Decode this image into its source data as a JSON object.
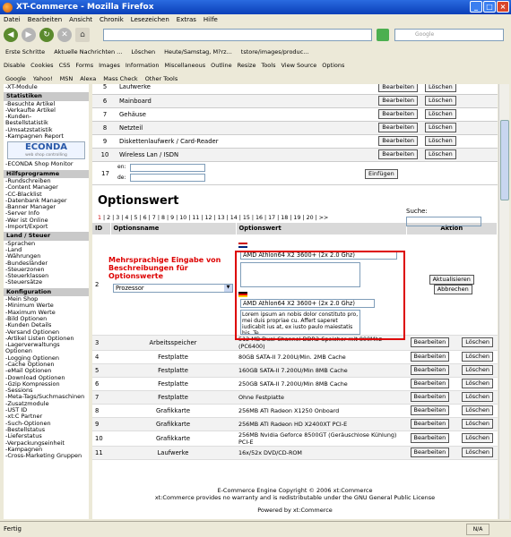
{
  "window": {
    "title": "XT-Commerce - Mozilla Firefox"
  },
  "menu": [
    "Datei",
    "Bearbeiten",
    "Ansicht",
    "Chronik",
    "Lesezeichen",
    "Extras",
    "Hilfe"
  ],
  "search": {
    "placeholder": "Google"
  },
  "bookmarks": [
    "Erste Schritte",
    "Aktuelle Nachrichten ...",
    "Löschen",
    "Heute/Samstag, M?rz...",
    "tstore/images/produc..."
  ],
  "devbar": [
    "Disable",
    "Cookies",
    "CSS",
    "Forms",
    "Images",
    "Information",
    "Miscellaneous",
    "Outline",
    "Resize",
    "Tools",
    "View Source",
    "Options"
  ],
  "googlebar": [
    "Google",
    "Yahoo!",
    "MSN",
    "Alexa",
    "Mass Check",
    "Other Tools"
  ],
  "sidebar": {
    "top_items": [
      "-XT-Module"
    ],
    "stats_title": "Statistiken",
    "stats_items": [
      "-Besuchte Artikel",
      "-Verkaufte Artikel",
      "-Kunden-",
      "Bestellstatistik",
      "-Umsatzstatistik",
      "-Kampagnen Report"
    ],
    "econda_logo": "ECONDA",
    "econda_sub": "web shop controlling",
    "econda_monitor": "-ECONDA Shop Monitor",
    "tools_title": "Hilfsprogramme",
    "tools_items": [
      "-Rundschreiben",
      "-Content Manager",
      "-CC-Blacklist",
      "-Datenbank Manager",
      "-Banner Manager",
      "-Server Info",
      "-Wer ist Online",
      "-Import/Export"
    ],
    "land_title": "Land / Steuer",
    "land_items": [
      "-Sprachen",
      "-Land",
      "-Währungen",
      "-Bundesländer",
      "-Steuerzonen",
      "-Steuerklassen",
      "-Steuersätze"
    ],
    "config_title": "Konfiguration",
    "config_items": [
      "-Mein Shop",
      "-Minimum Werte",
      "-Maximum Werte",
      "-Bild Optionen",
      "-Kunden Details",
      "-Versand Optionen",
      "-Artikel Listen Optionen",
      "-Lagerverwaltungs",
      "Optionen",
      "-Logging Optionen",
      "-Cache Optionen",
      "-eMail Optionen",
      "-Download Optionen",
      "-Gzip Kompression",
      "-Sessions",
      "-Meta-Tags/Suchmaschinen",
      "-Zusatzmodule",
      "-UST ID",
      "-xt:C Partner",
      "-Such-Optionen",
      "-Bestellstatus",
      "-Lieferstatus",
      "-Verpackungseinheit",
      "-Kampagnen",
      "-Cross-Marketing Gruppen"
    ]
  },
  "buttons": {
    "edit": "Bearbeiten",
    "delete": "Löschen",
    "add": "Einfügen",
    "update": "Aktualisieren",
    "cancel": "Abbrechen"
  },
  "top_rows": [
    {
      "id": "5",
      "name": "Laufwerke"
    },
    {
      "id": "6",
      "name": "Mainboard"
    },
    {
      "id": "7",
      "name": "Gehäuse"
    },
    {
      "id": "8",
      "name": "Netzteil"
    },
    {
      "id": "9",
      "name": "Diskettenlaufwerk / Card-Reader"
    },
    {
      "id": "10",
      "name": "Wireless Lan / ISDN"
    }
  ],
  "new_entry": {
    "id": "17",
    "label_en": "en:",
    "label_de": "de:"
  },
  "options_section": {
    "title": "Optionswert",
    "search_label": "Suche:",
    "pages_current": "1",
    "pages_rest": "| 2 | 3 | 4 | 5 | 6 | 7 | 8 | 9 | 10 | 11 | 12 | 13 | 14 | 15 | 16 | 17 | 18 | 19 | 20 | >>",
    "headers": {
      "id": "ID",
      "name": "Optionsname",
      "value": "Optionswert",
      "action": "Aktion"
    }
  },
  "annotation": "Mehrsprachige Eingabe von Beschreibungen für Optionswerte",
  "edit_row": {
    "id": "2",
    "option_select": "Prozessor",
    "value_en": "AMD Athlon64 X2 3600+ (2x 2.0 Ghz)",
    "value_de": "AMD Athlon64 X2 3600+ (2x 2.0 Ghz)",
    "desc_de": "Lorem ipsum an nobis dolor constituto pro, mei duis propriae cu. Affert saperet iudicabit ius at, ex iusto paulo maiestatis his. Te"
  },
  "value_rows": [
    {
      "id": "3",
      "name": "Arbeitsspeicher",
      "value": "512 MB Dual-Channel-DDR2-Speicher mit 800Mhz (PC6400)"
    },
    {
      "id": "4",
      "name": "Festplatte",
      "value": "80GB SATA-II 7.200U/Min. 2MB Cache"
    },
    {
      "id": "5",
      "name": "Festplatte",
      "value": "160GB SATA-II 7.200U/Min 8MB Cache"
    },
    {
      "id": "6",
      "name": "Festplatte",
      "value": "250GB SATA-II 7.200U/Min 8MB Cache"
    },
    {
      "id": "7",
      "name": "Festplatte",
      "value": "Ohne Festplatte"
    },
    {
      "id": "8",
      "name": "Grafikkarte",
      "value": "256MB ATI Radeon X1250 Onboard"
    },
    {
      "id": "9",
      "name": "Grafikkarte",
      "value": "256MB ATI Radeon HD X2400XT PCI-E"
    },
    {
      "id": "10",
      "name": "Grafikkarte",
      "value": "256MB Nvidia Geforce 8500GT (Geräuschlose Kühlung) PCI-E"
    },
    {
      "id": "11",
      "name": "Laufwerke",
      "value": "16x/52x DVD/CD-ROM"
    }
  ],
  "footer": {
    "line1": "E-Commerce Engine Copyright © 2006 xt:Commerce",
    "line2": "xt:Commerce provides no warranty and is redistributable under the GNU General Public License",
    "line3": "Powered by xt:Commerce"
  },
  "status": {
    "text": "Fertig",
    "zone": "N/A"
  }
}
